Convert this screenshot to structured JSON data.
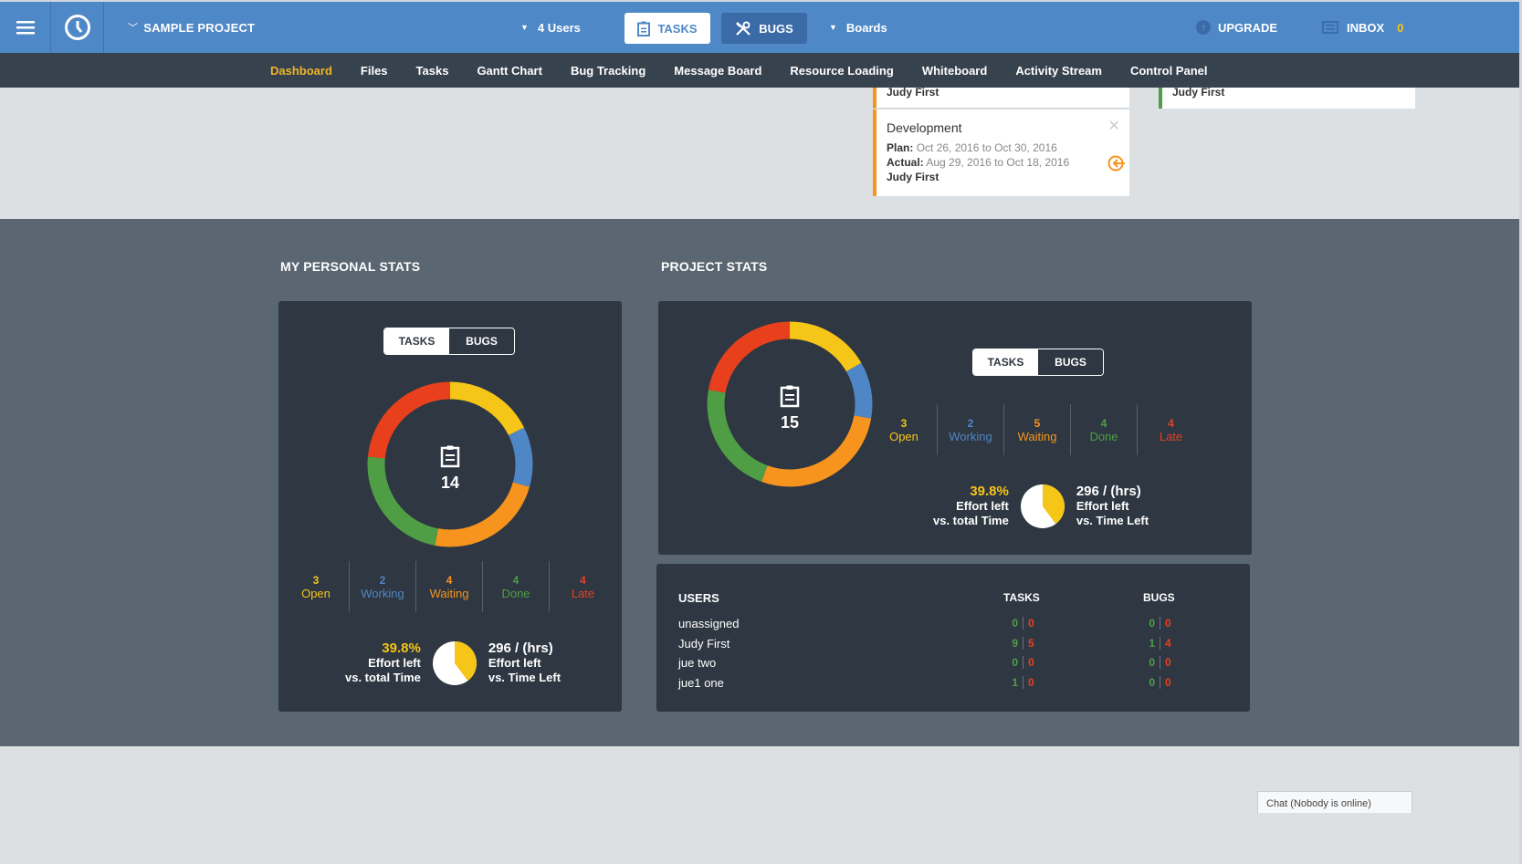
{
  "topbar": {
    "menu_icon": "hamburger-menu-icon",
    "logo_icon": "clock-icon",
    "project_label": "SAMPLE PROJECT",
    "users_label": "4 Users",
    "tasks_label": "TASKS",
    "bugs_label": "BUGS",
    "boards_label": "Boards",
    "upgrade_label": "UPGRADE",
    "inbox_label": "INBOX",
    "inbox_count": "0"
  },
  "nav": {
    "items": [
      {
        "label": "Dashboard",
        "active": true
      },
      {
        "label": "Files"
      },
      {
        "label": "Tasks"
      },
      {
        "label": "Gantt Chart"
      },
      {
        "label": "Bug Tracking"
      },
      {
        "label": "Message Board"
      },
      {
        "label": "Resource Loading"
      },
      {
        "label": "Whiteboard"
      },
      {
        "label": "Activity Stream"
      },
      {
        "label": "Control Panel"
      }
    ]
  },
  "milestones": {
    "card_a_owner": "Judy First",
    "card_b_owner": "Judy First",
    "dev": {
      "title": "Development",
      "plan_label": "Plan:",
      "plan_value": "Oct 26, 2016 to Oct 30, 2016",
      "actual_label": "Actual:",
      "actual_value": "Aug 29, 2016 to Oct 18, 2016",
      "owner": "Judy First"
    }
  },
  "colors": {
    "open": "#f5c518",
    "working": "#4f86c6",
    "waiting": "#f7941d",
    "done": "#4f9e45",
    "late": "#e8401c"
  },
  "personal": {
    "title": "MY PERSONAL STATS",
    "toggle": {
      "tasks": "TASKS",
      "bugs": "BUGS"
    },
    "total": "14",
    "counts": [
      {
        "key": "open",
        "num": "3",
        "label": "Open"
      },
      {
        "key": "working",
        "num": "2",
        "label": "Working"
      },
      {
        "key": "waiting",
        "num": "4",
        "label": "Waiting"
      },
      {
        "key": "done",
        "num": "4",
        "label": "Done"
      },
      {
        "key": "late",
        "num": "4",
        "label": "Late"
      }
    ],
    "effort_pct": "39.8%",
    "effort_pct_value": 39.8,
    "effort_left_l1": "Effort left",
    "effort_left_l2": "vs. total Time",
    "hours": "296 / (hrs)",
    "hours_l1": "Effort left",
    "hours_l2": "vs. Time Left"
  },
  "project": {
    "title": "PROJECT STATS",
    "toggle": {
      "tasks": "TASKS",
      "bugs": "BUGS"
    },
    "total": "15",
    "counts": [
      {
        "key": "open",
        "num": "3",
        "label": "Open"
      },
      {
        "key": "working",
        "num": "2",
        "label": "Working"
      },
      {
        "key": "waiting",
        "num": "5",
        "label": "Waiting"
      },
      {
        "key": "done",
        "num": "4",
        "label": "Done"
      },
      {
        "key": "late",
        "num": "4",
        "label": "Late"
      }
    ],
    "effort_pct": "39.8%",
    "effort_pct_value": 39.8,
    "effort_left_l1": "Effort left",
    "effort_left_l2": "vs. total Time",
    "hours": "296 / (hrs)",
    "hours_l1": "Effort left",
    "hours_l2": "vs. Time Left"
  },
  "users_table": {
    "headers": {
      "users": "USERS",
      "tasks": "TASKS",
      "bugs": "BUGS"
    },
    "rows": [
      {
        "name": "unassigned",
        "tasks_done": "0",
        "tasks_late": "0",
        "bugs_done": "0",
        "bugs_late": "0"
      },
      {
        "name": "Judy First",
        "tasks_done": "9",
        "tasks_late": "5",
        "bugs_done": "1",
        "bugs_late": "4"
      },
      {
        "name": "jue two",
        "tasks_done": "0",
        "tasks_late": "0",
        "bugs_done": "0",
        "bugs_late": "0"
      },
      {
        "name": "jue1 one",
        "tasks_done": "1",
        "tasks_late": "0",
        "bugs_done": "0",
        "bugs_late": "0"
      }
    ]
  },
  "chat": {
    "label": "Chat (Nobody is online)"
  }
}
